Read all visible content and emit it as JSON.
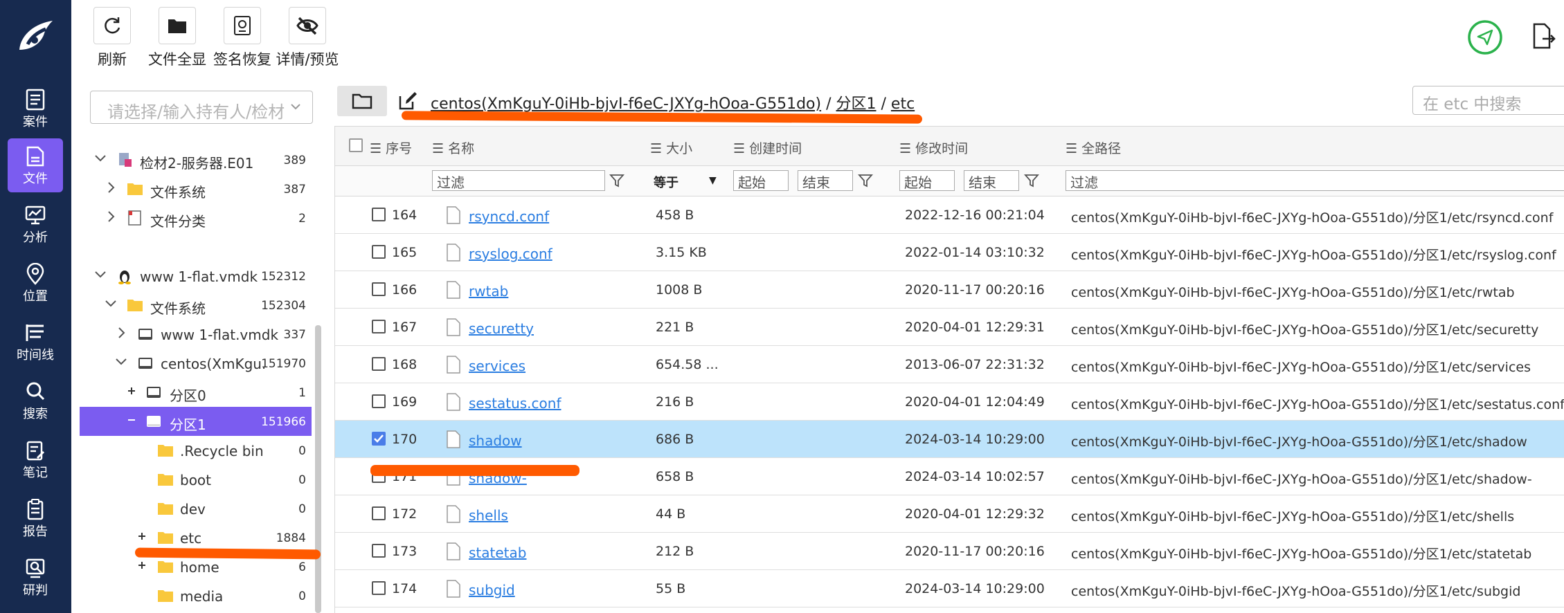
{
  "nav": {
    "items": [
      {
        "label": "案件",
        "icon": "case-icon"
      },
      {
        "label": "文件",
        "icon": "file-icon"
      },
      {
        "label": "分析",
        "icon": "analysis-icon"
      },
      {
        "label": "位置",
        "icon": "location-icon"
      },
      {
        "label": "时间线",
        "icon": "timeline-icon"
      },
      {
        "label": "搜索",
        "icon": "search-icon"
      },
      {
        "label": "笔记",
        "icon": "note-icon"
      },
      {
        "label": "报告",
        "icon": "report-icon"
      },
      {
        "label": "研判",
        "icon": "research-icon"
      }
    ]
  },
  "toolbar": {
    "refresh": "刷新",
    "show_all": "文件全显",
    "sig_restore": "签名恢复",
    "details": "详情/预览"
  },
  "tree": {
    "owner_placeholder": "请选择/输入持有人/检材",
    "nodes": [
      {
        "label": "检材2-服务器.E01",
        "count": "389"
      },
      {
        "label": "文件系统",
        "count": "387"
      },
      {
        "label": "文件分类",
        "count": "2"
      },
      {
        "label": "www 1-flat.vmdk ...",
        "count": "152312"
      },
      {
        "label": "文件系统",
        "count": "152304"
      },
      {
        "label": "www 1-flat.vmdk",
        "count": "337"
      },
      {
        "label": "centos(XmKgu...",
        "count": "151970"
      },
      {
        "label": "分区0",
        "count": "1"
      },
      {
        "label": "分区1",
        "count": "151966"
      },
      {
        "label": ".Recycle bin",
        "count": "0"
      },
      {
        "label": "boot",
        "count": "0"
      },
      {
        "label": "dev",
        "count": "0"
      },
      {
        "label": "etc",
        "count": "1884"
      },
      {
        "label": "home",
        "count": "6"
      },
      {
        "label": "media",
        "count": "0"
      }
    ]
  },
  "pathbar": {
    "seg1": "centos(XmKguY-0iHb-bjvI-f6eC-JXYg-hOoa-G551do)",
    "sep": " / ",
    "seg2": "分区1",
    "seg3": "etc",
    "search_placeholder": "在 etc 中搜索"
  },
  "grid": {
    "headers": {
      "index": "序号",
      "name": "名称",
      "size": "大小",
      "ctime": "创建时间",
      "mtime": "修改时间",
      "path": "全路径"
    },
    "filter": {
      "placeholder": "过滤",
      "op": "等于",
      "start": "起始",
      "end": "结束"
    },
    "rows": [
      {
        "n": "164",
        "name": "rsyncd.conf",
        "size": "458 B",
        "mtime": "2022-12-16 00:21:04",
        "path": "centos(XmKguY-0iHb-bjvI-f6eC-JXYg-hOoa-G551do)/分区1/etc/rsyncd.conf"
      },
      {
        "n": "165",
        "name": "rsyslog.conf",
        "size": "3.15 KB",
        "mtime": "2022-01-14 03:10:32",
        "path": "centos(XmKguY-0iHb-bjvI-f6eC-JXYg-hOoa-G551do)/分区1/etc/rsyslog.conf"
      },
      {
        "n": "166",
        "name": "rwtab",
        "size": "1008 B",
        "mtime": "2020-11-17 00:20:16",
        "path": "centos(XmKguY-0iHb-bjvI-f6eC-JXYg-hOoa-G551do)/分区1/etc/rwtab"
      },
      {
        "n": "167",
        "name": "securetty",
        "size": "221 B",
        "mtime": "2020-04-01 12:29:31",
        "path": "centos(XmKguY-0iHb-bjvI-f6eC-JXYg-hOoa-G551do)/分区1/etc/securetty"
      },
      {
        "n": "168",
        "name": "services",
        "size": "654.58 ...",
        "mtime": "2013-06-07 22:31:32",
        "path": "centos(XmKguY-0iHb-bjvI-f6eC-JXYg-hOoa-G551do)/分区1/etc/services"
      },
      {
        "n": "169",
        "name": "sestatus.conf",
        "size": "216 B",
        "mtime": "2020-04-01 12:04:49",
        "path": "centos(XmKguY-0iHb-bjvI-f6eC-JXYg-hOoa-G551do)/分区1/etc/sestatus.conf"
      },
      {
        "n": "170",
        "name": "shadow",
        "size": "686 B",
        "mtime": "2024-03-14 10:29:00",
        "path": "centos(XmKguY-0iHb-bjvI-f6eC-JXYg-hOoa-G551do)/分区1/etc/shadow",
        "selected": true
      },
      {
        "n": "171",
        "name": "shadow-",
        "size": "658 B",
        "mtime": "2024-03-14 10:02:57",
        "path": "centos(XmKguY-0iHb-bjvI-f6eC-JXYg-hOoa-G551do)/分区1/etc/shadow-"
      },
      {
        "n": "172",
        "name": "shells",
        "size": "44 B",
        "mtime": "2020-04-01 12:29:32",
        "path": "centos(XmKguY-0iHb-bjvI-f6eC-JXYg-hOoa-G551do)/分区1/etc/shells"
      },
      {
        "n": "173",
        "name": "statetab",
        "size": "212 B",
        "mtime": "2020-11-17 00:20:16",
        "path": "centos(XmKguY-0iHb-bjvI-f6eC-JXYg-hOoa-G551do)/分区1/etc/statetab"
      },
      {
        "n": "174",
        "name": "subgid",
        "size": "55 B",
        "mtime": "2024-03-14 10:29:00",
        "path": "centos(XmKguY-0iHb-bjvI-f6eC-JXYg-hOoa-G551do)/分区1/etc/subgid"
      }
    ]
  },
  "colors": {
    "nav_bg": "#172a4f",
    "accent": "#7b5cf0",
    "link": "#2a7de1",
    "selected_row": "#bde3fb",
    "annotation": "#ff5a00",
    "send_icon": "#2bb24c"
  }
}
